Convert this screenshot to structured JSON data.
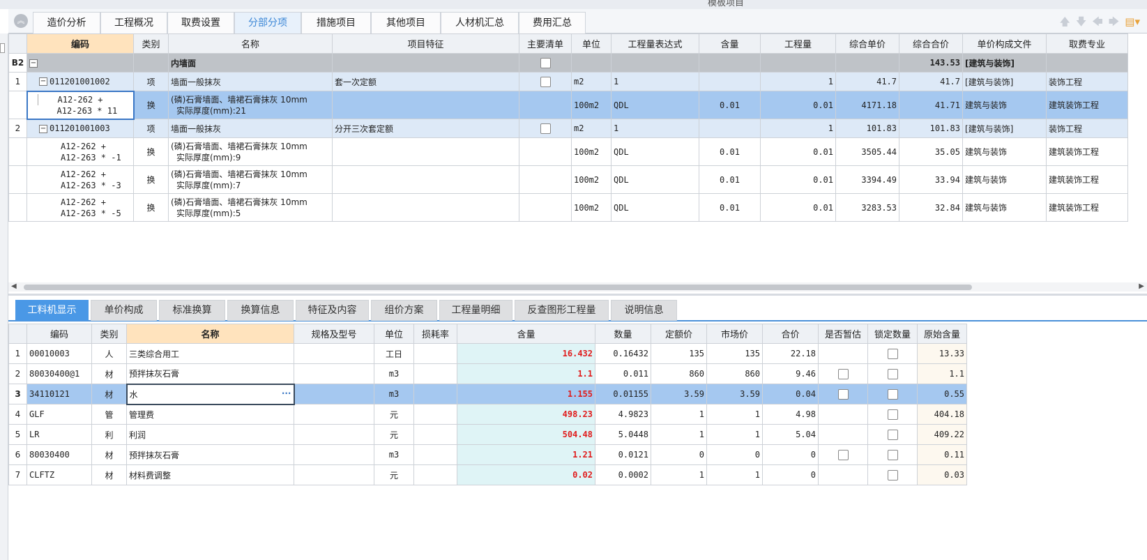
{
  "window": {
    "title": "模板项目"
  },
  "main_tabs": [
    {
      "label": "造价分析"
    },
    {
      "label": "工程概况"
    },
    {
      "label": "取费设置"
    },
    {
      "label": "分部分项"
    },
    {
      "label": "措施项目"
    },
    {
      "label": "其他项目"
    },
    {
      "label": "人材机汇总"
    },
    {
      "label": "费用汇总"
    }
  ],
  "active_main_tab": "分部分项",
  "upper_table": {
    "headers": [
      "编码",
      "类别",
      "名称",
      "项目特征",
      "主要清单",
      "单位",
      "工程量表达式",
      "含量",
      "工程量",
      "综合单价",
      "综合合价",
      "单价构成文件",
      "取费专业"
    ],
    "section": {
      "num": "B2",
      "name": "内墙面",
      "total": "143.53",
      "file": "[建筑与装饰]"
    },
    "items": [
      {
        "num": "1",
        "code": "011201001002",
        "type": "项",
        "name": "墙面一般抹灰",
        "feature": "套一次定额",
        "unit": "m2",
        "expr": "1",
        "qty": "1",
        "price": "41.7",
        "total": "41.7",
        "file": "[建筑与装饰]",
        "spec": "装饰工程",
        "subs": [
          {
            "code1": "A12-262 +",
            "code2": "A12-263 * 11",
            "type": "换",
            "name1": "(磷)石膏墙面、墙裙石膏抹灰 10mm",
            "name2": "实际厚度(mm):21",
            "unit": "100m2",
            "expr": "QDL",
            "content": "0.01",
            "qty": "0.01",
            "price": "4171.18",
            "total": "41.71",
            "file": "建筑与装饰",
            "spec": "建筑装饰工程"
          }
        ]
      },
      {
        "num": "2",
        "code": "011201001003",
        "type": "项",
        "name": "墙面一般抹灰",
        "feature": "分开三次套定额",
        "unit": "m2",
        "expr": "1",
        "qty": "1",
        "price": "101.83",
        "total": "101.83",
        "file": "[建筑与装饰]",
        "spec": "装饰工程",
        "subs": [
          {
            "code1": "A12-262 +",
            "code2": "A12-263 * -1",
            "type": "换",
            "name1": "(磷)石膏墙面、墙裙石膏抹灰 10mm",
            "name2": "实际厚度(mm):9",
            "unit": "100m2",
            "expr": "QDL",
            "content": "0.01",
            "qty": "0.01",
            "price": "3505.44",
            "total": "35.05",
            "file": "建筑与装饰",
            "spec": "建筑装饰工程"
          },
          {
            "code1": "A12-262 +",
            "code2": "A12-263 * -3",
            "type": "换",
            "name1": "(磷)石膏墙面、墙裙石膏抹灰 10mm",
            "name2": "实际厚度(mm):7",
            "unit": "100m2",
            "expr": "QDL",
            "content": "0.01",
            "qty": "0.01",
            "price": "3394.49",
            "total": "33.94",
            "file": "建筑与装饰",
            "spec": "建筑装饰工程"
          },
          {
            "code1": "A12-262 +",
            "code2": "A12-263 * -5",
            "type": "换",
            "name1": "(磷)石膏墙面、墙裙石膏抹灰 10mm",
            "name2": "实际厚度(mm):5",
            "unit": "100m2",
            "expr": "QDL",
            "content": "0.01",
            "qty": "0.01",
            "price": "3283.53",
            "total": "32.84",
            "file": "建筑与装饰",
            "spec": "建筑装饰工程"
          }
        ]
      }
    ]
  },
  "sub_tabs": [
    {
      "label": "工料机显示"
    },
    {
      "label": "单价构成"
    },
    {
      "label": "标准换算"
    },
    {
      "label": "换算信息"
    },
    {
      "label": "特征及内容"
    },
    {
      "label": "组价方案"
    },
    {
      "label": "工程量明细"
    },
    {
      "label": "反查图形工程量"
    },
    {
      "label": "说明信息"
    }
  ],
  "active_sub_tab": "工料机显示",
  "lower_table": {
    "headers": [
      "编码",
      "类别",
      "名称",
      "规格及型号",
      "单位",
      "损耗率",
      "含量",
      "数量",
      "定额价",
      "市场价",
      "合价",
      "是否暂估",
      "锁定数量",
      "原始含量"
    ],
    "rows": [
      {
        "num": "1",
        "code": "00010003",
        "type": "人",
        "name": "三类综合用工",
        "unit": "工日",
        "content": "16.432",
        "amount": "0.16432",
        "base": "135",
        "market": "135",
        "total": "22.18",
        "estimate_box": false,
        "orig": "13.33"
      },
      {
        "num": "2",
        "code": "80030400@1",
        "type": "材",
        "name": "预拌抹灰石膏",
        "unit": "m3",
        "content": "1.1",
        "amount": "0.011",
        "base": "860",
        "market": "860",
        "total": "9.46",
        "estimate_box": true,
        "orig": "1.1"
      },
      {
        "num": "3",
        "code": "34110121",
        "type": "材",
        "name": "水",
        "unit": "m3",
        "content": "1.155",
        "amount": "0.01155",
        "base": "3.59",
        "market": "3.59",
        "total": "0.04",
        "estimate_box": true,
        "orig": "0.55"
      },
      {
        "num": "4",
        "code": "GLF",
        "type": "管",
        "name": "管理费",
        "unit": "元",
        "content": "498.23",
        "amount": "4.9823",
        "base": "1",
        "market": "1",
        "total": "4.98",
        "estimate_box": false,
        "orig": "404.18"
      },
      {
        "num": "5",
        "code": "LR",
        "type": "利",
        "name": "利润",
        "unit": "元",
        "content": "504.48",
        "amount": "5.0448",
        "base": "1",
        "market": "1",
        "total": "5.04",
        "estimate_box": false,
        "orig": "409.22"
      },
      {
        "num": "6",
        "code": "80030400",
        "type": "材",
        "name": "预拌抹灰石膏",
        "unit": "m3",
        "content": "1.21",
        "amount": "0.0121",
        "base": "0",
        "market": "0",
        "total": "0",
        "estimate_box": true,
        "orig": "0.11"
      },
      {
        "num": "7",
        "code": "CLFTZ",
        "type": "材",
        "name": "材料费调整",
        "unit": "元",
        "content": "0.02",
        "amount": "0.0002",
        "base": "1",
        "market": "1",
        "total": "0",
        "estimate_box": false,
        "orig": "0.03"
      }
    ]
  },
  "icons": {
    "collapse": "chevron-up-double-icon",
    "nav": [
      "arrow-up-icon",
      "arrow-down-icon",
      "arrow-left-icon",
      "arrow-right-icon"
    ],
    "tool": "settings-tool-icon"
  },
  "colors": {
    "accent": "#4a98e6",
    "selected_row": "#a5c8f0",
    "content_red": "#e01b1b"
  }
}
